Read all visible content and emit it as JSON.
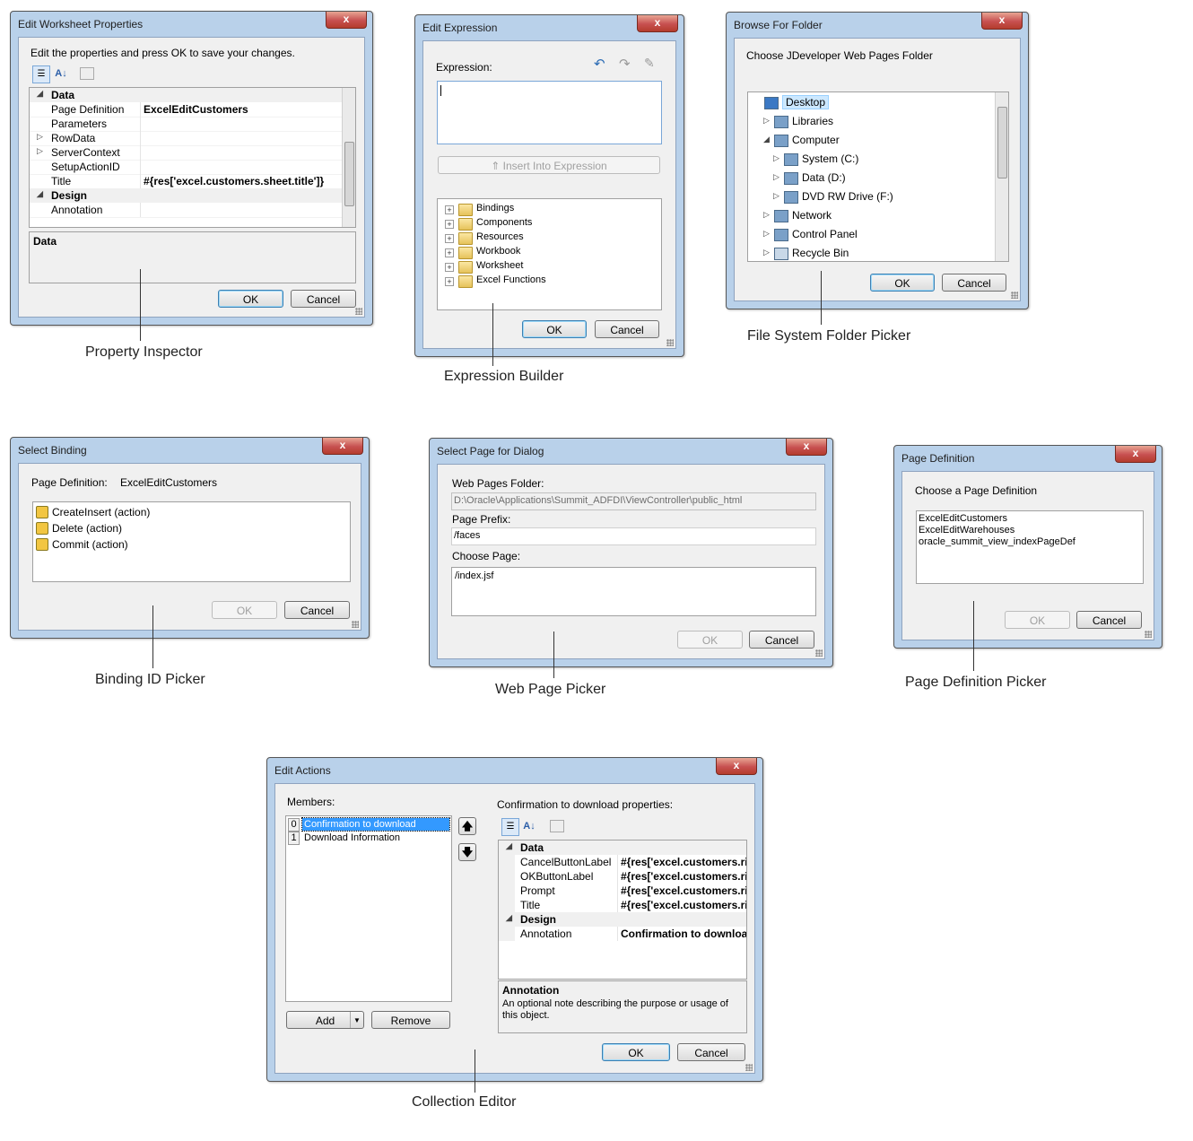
{
  "property_inspector": {
    "title": "Edit Worksheet Properties",
    "close": "x",
    "instructions": "Edit the properties and press OK to save your changes.",
    "rows": [
      {
        "name": "Data",
        "value": "",
        "category": true
      },
      {
        "name": "Page Definition",
        "value": "ExcelEditCustomers"
      },
      {
        "name": "Parameters",
        "value": ""
      },
      {
        "name": "RowData",
        "value": "",
        "expandable": true
      },
      {
        "name": "ServerContext",
        "value": "",
        "expandable": true
      },
      {
        "name": "SetupActionID",
        "value": ""
      },
      {
        "name": "Title",
        "value": "#{res['excel.customers.sheet.title']}"
      },
      {
        "name": "Design",
        "value": "",
        "category": true
      },
      {
        "name": "Annotation",
        "value": ""
      }
    ],
    "description_title": "Data",
    "ok": "OK",
    "cancel": "Cancel",
    "caption": "Property Inspector"
  },
  "expression_builder": {
    "title": "Edit Expression",
    "close": "x",
    "expression_label": "Expression:",
    "insert_button": "Insert Into Expression",
    "tree": [
      "Bindings",
      "Components",
      "Resources",
      "Workbook",
      "Worksheet",
      "Excel Functions"
    ],
    "ok": "OK",
    "cancel": "Cancel",
    "caption": "Expression Builder"
  },
  "folder_picker": {
    "title": "Browse For Folder",
    "close": "x",
    "instructions": "Choose JDeveloper Web Pages Folder",
    "tree": [
      {
        "label": "Desktop",
        "level": 0,
        "selected": true
      },
      {
        "label": "Libraries",
        "level": 1
      },
      {
        "label": "Computer",
        "level": 1,
        "expanded": true
      },
      {
        "label": "System (C:)",
        "level": 2
      },
      {
        "label": "Data (D:)",
        "level": 2
      },
      {
        "label": "DVD RW Drive (F:)",
        "level": 2
      },
      {
        "label": "Network",
        "level": 1
      },
      {
        "label": "Control Panel",
        "level": 1
      },
      {
        "label": "Recycle Bin",
        "level": 1
      }
    ],
    "ok": "OK",
    "cancel": "Cancel",
    "caption": "File System Folder Picker"
  },
  "binding_picker": {
    "title": "Select Binding",
    "close": "x",
    "page_definition_label": "Page Definition:",
    "page_definition_value": "ExcelEditCustomers",
    "items": [
      "CreateInsert (action)",
      "Delete (action)",
      "Commit (action)"
    ],
    "ok": "OK",
    "cancel": "Cancel",
    "caption": "Binding ID Picker"
  },
  "web_page_picker": {
    "title": "Select Page for Dialog",
    "close": "x",
    "folder_label": "Web Pages Folder:",
    "folder_value": "D:\\Oracle\\Applications\\Summit_ADFDI\\ViewController\\public_html",
    "prefix_label": "Page Prefix:",
    "prefix_value": "/faces",
    "choose_label": "Choose Page:",
    "pages": [
      "/index.jsf"
    ],
    "ok": "OK",
    "cancel": "Cancel",
    "caption": "Web Page Picker"
  },
  "page_def_picker": {
    "title": "Page Definition",
    "close": "x",
    "instructions": "Choose a Page Definition",
    "items": [
      "ExcelEditCustomers",
      "ExcelEditWarehouses",
      "oracle_summit_view_indexPageDef"
    ],
    "ok": "OK",
    "cancel": "Cancel",
    "caption": "Page Definition Picker"
  },
  "collection_editor": {
    "title": "Edit Actions",
    "close": "x",
    "members_label": "Members:",
    "members": [
      {
        "index": "0",
        "label": "Confirmation to download"
      },
      {
        "index": "1",
        "label": "Download Information"
      }
    ],
    "add": "Add",
    "remove": "Remove",
    "properties_label": "Confirmation to download properties:",
    "rows": [
      {
        "name": "Data",
        "value": "",
        "category": true
      },
      {
        "name": "CancelButtonLabel",
        "value": "#{res['excel.customers.ri"
      },
      {
        "name": "OKButtonLabel",
        "value": "#{res['excel.customers.ri"
      },
      {
        "name": "Prompt",
        "value": "#{res['excel.customers.ri"
      },
      {
        "name": "Title",
        "value": "#{res['excel.customers.ri"
      },
      {
        "name": "Design",
        "value": "",
        "category": true
      },
      {
        "name": "Annotation",
        "value": "Confirmation to download"
      }
    ],
    "description_title": "Annotation",
    "description_text": "An optional note describing the purpose or usage of this object.",
    "ok": "OK",
    "cancel": "Cancel",
    "caption": "Collection Editor"
  }
}
